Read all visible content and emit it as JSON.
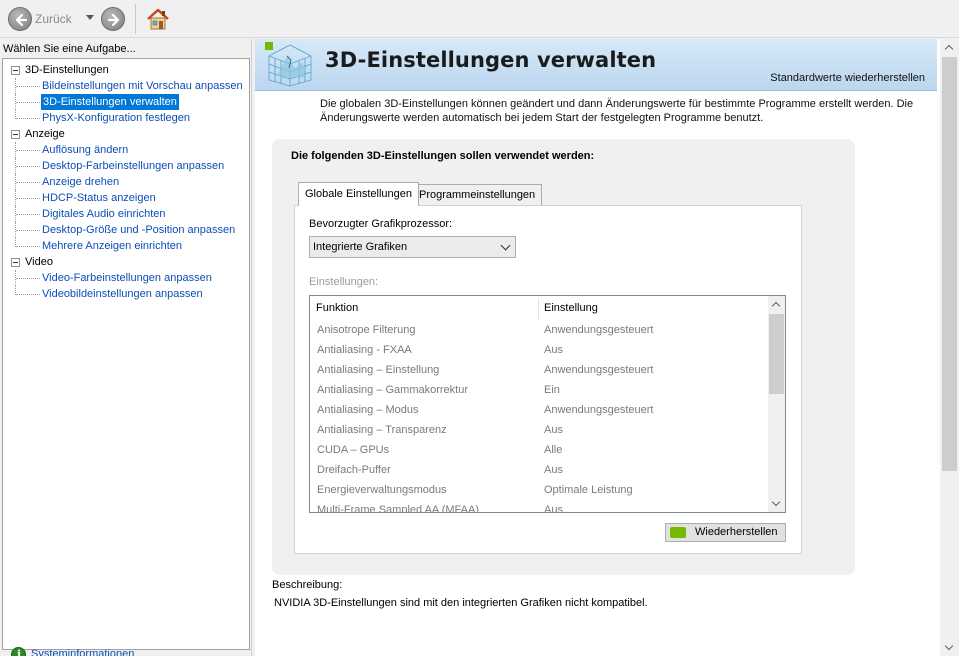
{
  "toolbar": {
    "back_label": "Zurück"
  },
  "left": {
    "task_label": "Wählen Sie eine Aufgabe...",
    "tree": [
      {
        "label": "3D-Einstellungen",
        "children": [
          "Bildeinstellungen mit Vorschau anpassen",
          "3D-Einstellungen verwalten",
          "PhysX-Konfiguration festlegen"
        ]
      },
      {
        "label": "Anzeige",
        "children": [
          "Auflösung ändern",
          "Desktop-Farbeinstellungen anpassen",
          "Anzeige drehen",
          "HDCP-Status anzeigen",
          "Digitales Audio einrichten",
          "Desktop-Größe und -Position anpassen",
          "Mehrere Anzeigen einrichten"
        ]
      },
      {
        "label": "Video",
        "children": [
          "Video-Farbeinstellungen anpassen",
          "Videobildeinstellungen anpassen"
        ]
      }
    ],
    "selected_item": "3D-Einstellungen verwalten",
    "sysinfo_link": "Systeminformationen"
  },
  "main": {
    "title": "3D-Einstellungen verwalten",
    "restore_defaults": "Standardwerte wiederherstellen",
    "intro": "Die globalen 3D-Einstellungen können geändert und dann Änderungswerte für bestimmte Programme erstellt werden. Die Änderungswerte werden automatisch bei jedem Start der festgelegten Programme benutzt.",
    "card_heading": "Die folgenden 3D-Einstellungen sollen verwendet werden:",
    "tabs": [
      "Globale Einstellungen",
      "Programmeinstellungen"
    ],
    "gpu_label": "Bevorzugter Grafikprozessor:",
    "gpu_value": "Integrierte Grafiken",
    "settings_label": "Einstellungen:",
    "table_headers": [
      "Funktion",
      "Einstellung"
    ],
    "table_rows": [
      [
        "Anisotrope Filterung",
        "Anwendungsgesteuert"
      ],
      [
        "Antialiasing - FXAA",
        "Aus"
      ],
      [
        "Antialiasing – Einstellung",
        "Anwendungsgesteuert"
      ],
      [
        "Antialiasing – Gammakorrektur",
        "Ein"
      ],
      [
        "Antialiasing – Modus",
        "Anwendungsgesteuert"
      ],
      [
        "Antialiasing – Transparenz",
        "Aus"
      ],
      [
        "CUDA – GPUs",
        "Alle"
      ],
      [
        "Dreifach-Puffer",
        "Aus"
      ],
      [
        "Energieverwaltungsmodus",
        "Optimale Leistung"
      ],
      [
        "Multi-Frame Sampled AA (MFAA)",
        "Aus"
      ]
    ],
    "restore_button": "Wiederherstellen",
    "description_label": "Beschreibung:",
    "description_text": "NVIDIA 3D-Einstellungen sind mit den integrierten Grafiken nicht kompatibel."
  },
  "colors": {
    "link": "#0a4fb5",
    "selection": "#0078d7",
    "nvidia_green": "#76b900",
    "banner": "#c7def3"
  }
}
